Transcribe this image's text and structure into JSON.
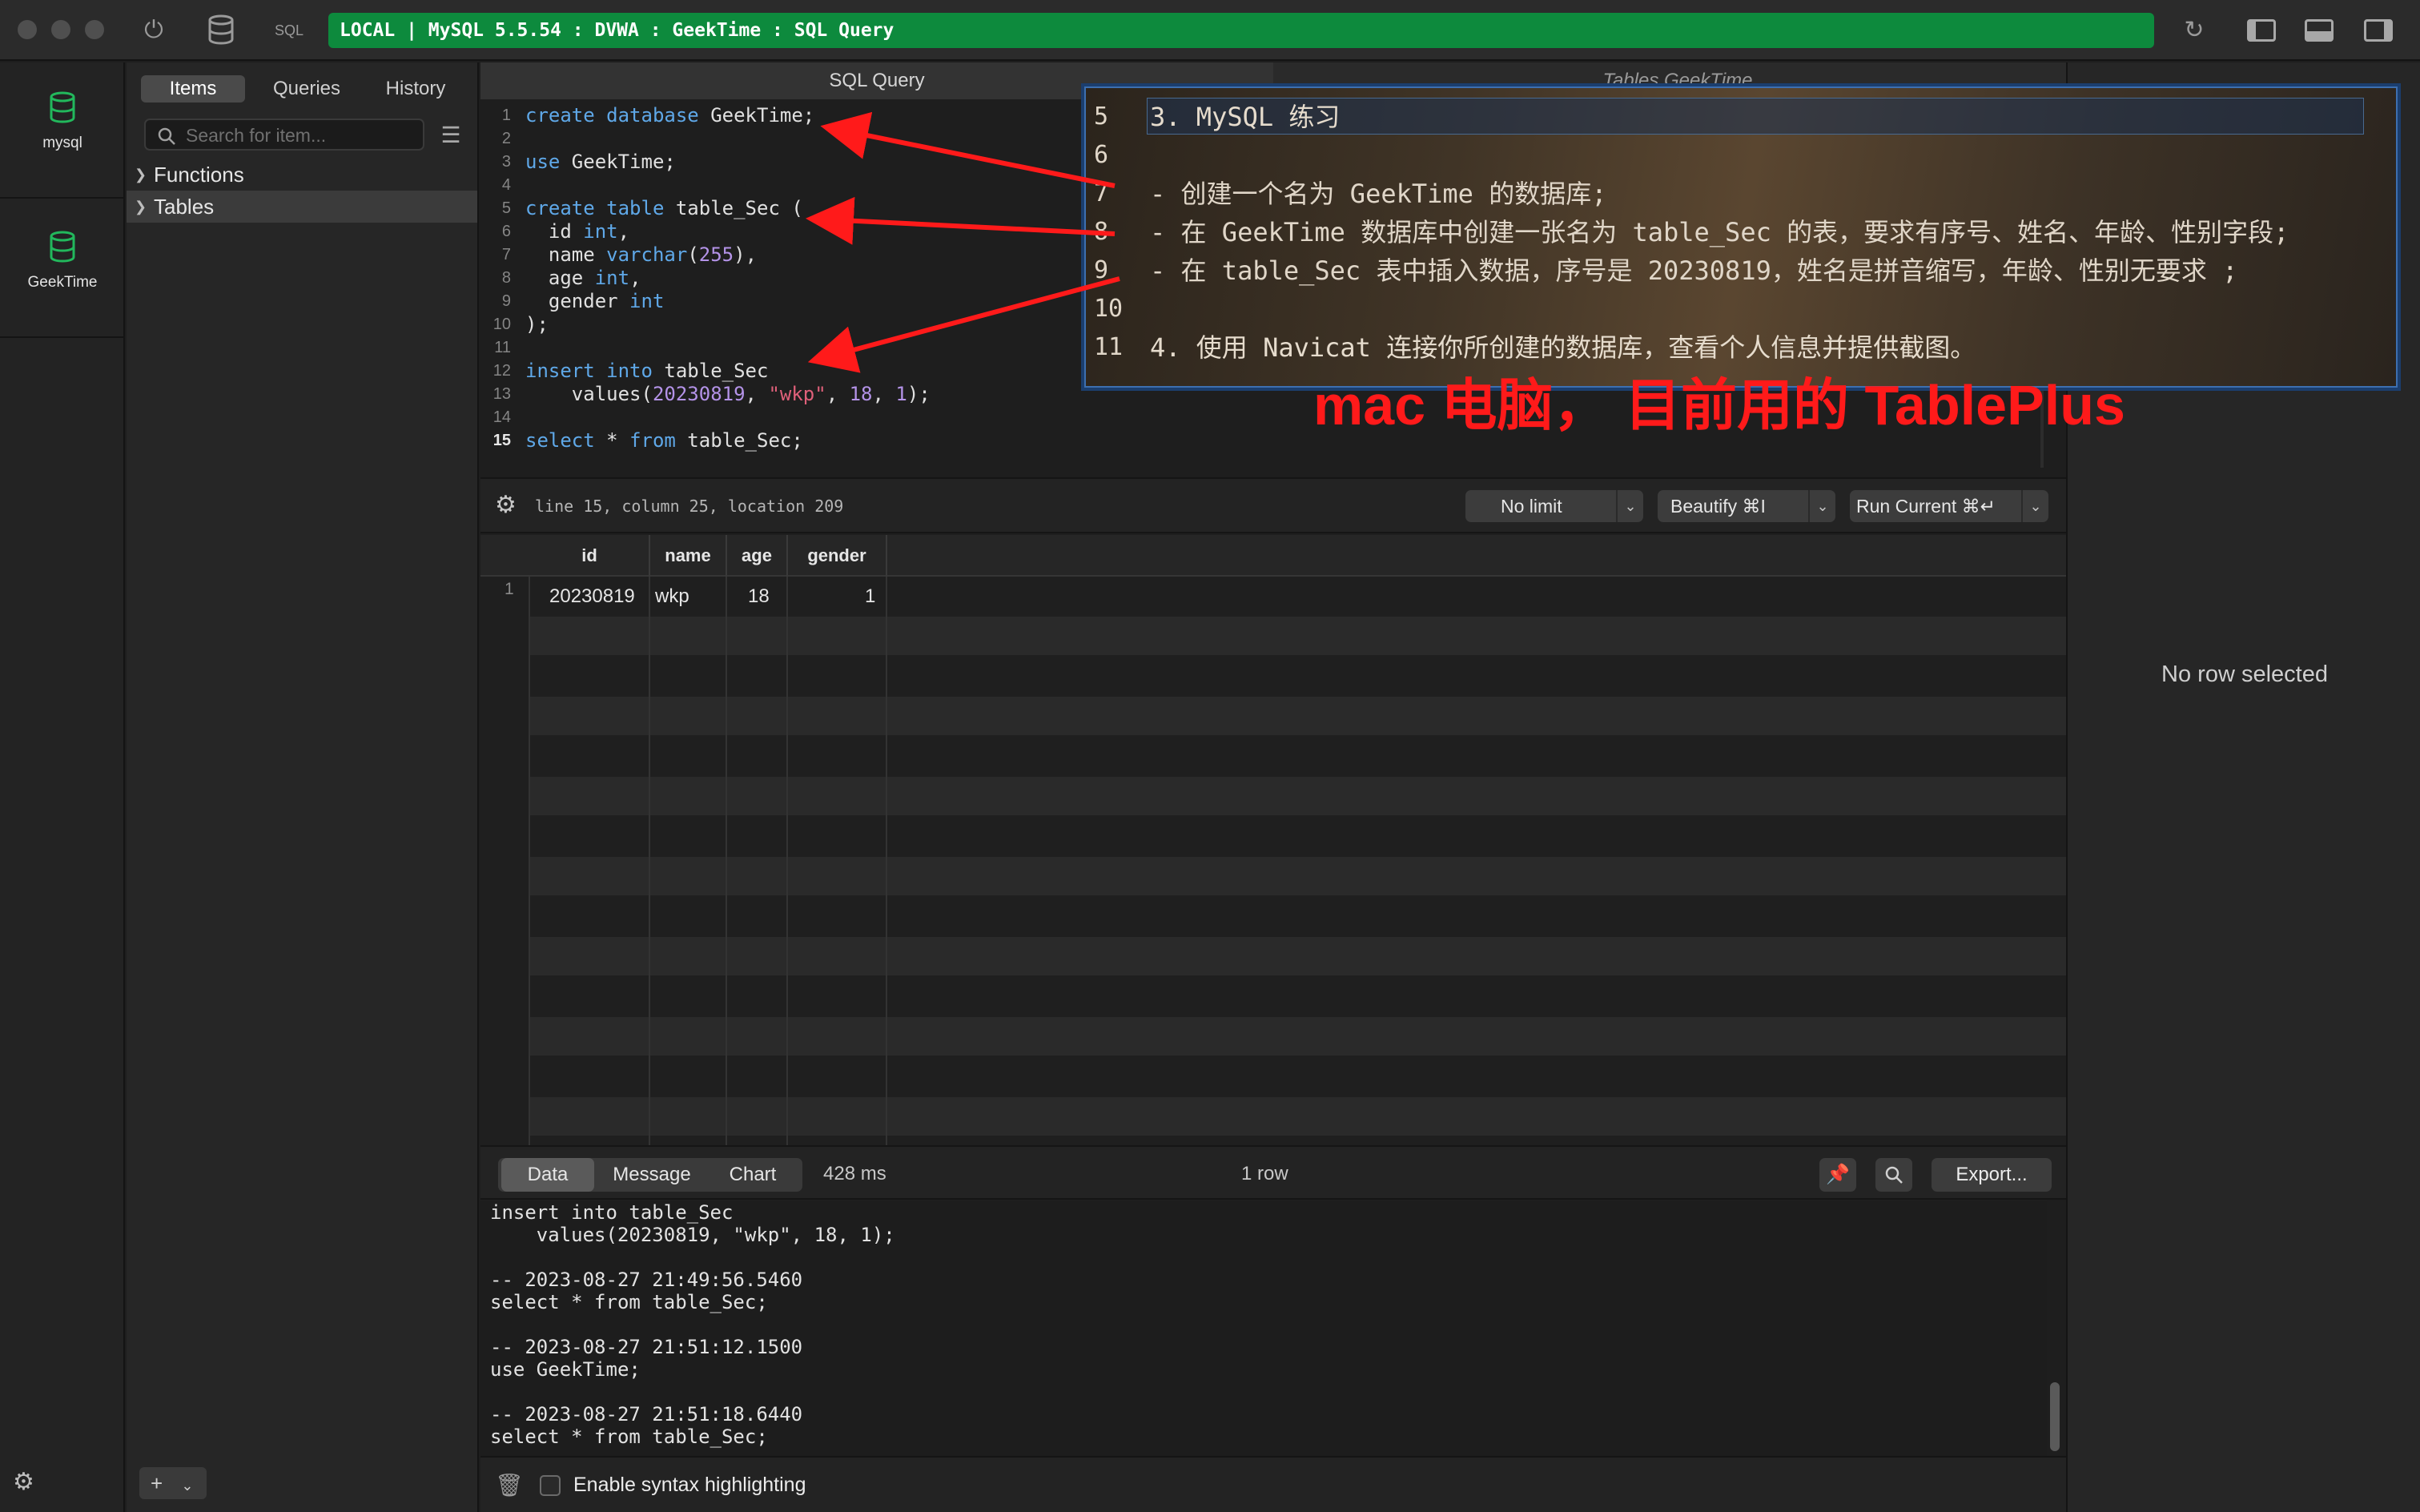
{
  "titlebar": {
    "connection": "LOCAL | MySQL 5.5.54 : DVWA : GeekTime : SQL Query",
    "sql_label": "SQL"
  },
  "databases": [
    {
      "name": "mysql"
    },
    {
      "name": "GeekTime"
    }
  ],
  "sidebar": {
    "tabs": [
      "Items",
      "Queries",
      "History"
    ],
    "active_tab": "Items",
    "search_placeholder": "Search for item...",
    "tree": [
      {
        "label": "Functions",
        "selected": false
      },
      {
        "label": "Tables",
        "selected": true
      }
    ]
  },
  "editor": {
    "tabs": [
      "SQL Query",
      "Tables GeekTime"
    ],
    "lines": [
      {
        "n": "1",
        "text": "create database GeekTime;"
      },
      {
        "n": "2",
        "text": ""
      },
      {
        "n": "3",
        "text": "use GeekTime;"
      },
      {
        "n": "4",
        "text": ""
      },
      {
        "n": "5",
        "text": "create table table_Sec ("
      },
      {
        "n": "6",
        "text": "  id int,"
      },
      {
        "n": "7",
        "text": "  name varchar(255),"
      },
      {
        "n": "8",
        "text": "  age int,"
      },
      {
        "n": "9",
        "text": "  gender int"
      },
      {
        "n": "10",
        "text": ");"
      },
      {
        "n": "11",
        "text": ""
      },
      {
        "n": "12",
        "text": "insert into table_Sec"
      },
      {
        "n": "13",
        "text": "    values(20230819, \"wkp\", 18, 1);"
      },
      {
        "n": "14",
        "text": ""
      },
      {
        "n": "15",
        "text": "select * from table_Sec;"
      }
    ],
    "current_line": "15",
    "status": "line 15, column 25, location 209",
    "limit_label": "No limit",
    "beautify_label": "Beautify ⌘I",
    "run_label": "Run Current ⌘↵"
  },
  "results": {
    "columns": [
      "id",
      "name",
      "age",
      "gender"
    ],
    "rows": [
      {
        "n": "1",
        "id": "20230819",
        "name": "wkp",
        "age": "18",
        "gender": "1"
      }
    ],
    "tabs": [
      "Data",
      "Message",
      "Chart"
    ],
    "active_tab": "Data",
    "time": "428 ms",
    "row_count": "1 row",
    "export_label": "Export..."
  },
  "log": {
    "lines": [
      "insert into table_Sec",
      "    values(20230819, \"wkp\", 18, 1);",
      "",
      "-- 2023-08-27 21:49:56.5460",
      "select * from table_Sec;",
      "",
      "-- 2023-08-27 21:51:12.1500",
      "use GeekTime;",
      "",
      "-- 2023-08-27 21:51:18.6440",
      "select * from table_Sec;"
    ],
    "syntax_label": "Enable syntax highlighting"
  },
  "right_panel": {
    "empty_text": "No row selected"
  },
  "overlay": {
    "lines": [
      {
        "n": "5",
        "text": "3. MySQL 练习"
      },
      {
        "n": "6",
        "text": ""
      },
      {
        "n": "7",
        "text": "- 创建一个名为 GeekTime 的数据库;"
      },
      {
        "n": "8",
        "text": "- 在 GeekTime 数据库中创建一张名为 table_Sec 的表，要求有序号、姓名、年龄、性别字段;"
      },
      {
        "n": "9",
        "text": "- 在 table_Sec 表中插入数据，序号是 20230819，姓名是拼音缩写，年龄、性别无要求 ;"
      },
      {
        "n": "10",
        "text": ""
      },
      {
        "n": "11",
        "text": "4. 使用 Navicat 连接你所创建的数据库，查看个人信息并提供截图。"
      }
    ],
    "caption": "mac 电脑， 目前用的 TablePlus"
  },
  "colors": {
    "connection_bar": "#0d8a3d",
    "annotation_red": "#ff1a1a",
    "keyword_blue": "#5fa8e8",
    "number_purple": "#b493e8",
    "string_red": "#e0607a"
  }
}
